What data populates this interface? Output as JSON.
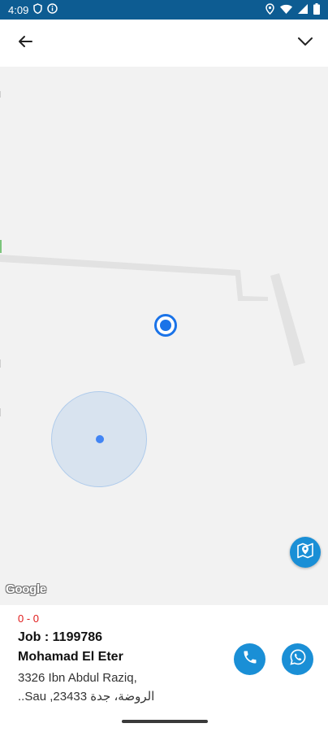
{
  "status_bar": {
    "time": "4:09",
    "icons": [
      "shield-icon",
      "info-icon",
      "location-icon",
      "wifi-icon",
      "signal-icon",
      "battery-icon"
    ]
  },
  "app_bar": {
    "back_icon": "arrow-back-icon",
    "collapse_icon": "chevron-down-icon"
  },
  "map": {
    "attribution": "Google",
    "fab_icon": "map-marker-icon",
    "user_location_color": "#1a73e8"
  },
  "job": {
    "counter": "0 - 0",
    "title": "Job : 1199786",
    "customer_name": "Mohamad El Eter",
    "address_line1": "3326 Ibn Abdul Raziq,",
    "address_line2": "الروضة، جدة 23433, Sau..",
    "call_icon": "phone-icon",
    "whatsapp_icon": "whatsapp-icon"
  },
  "colors": {
    "status_bar": "#0d5c92",
    "accent": "#1a8fd6",
    "counter": "#e01b1b"
  }
}
